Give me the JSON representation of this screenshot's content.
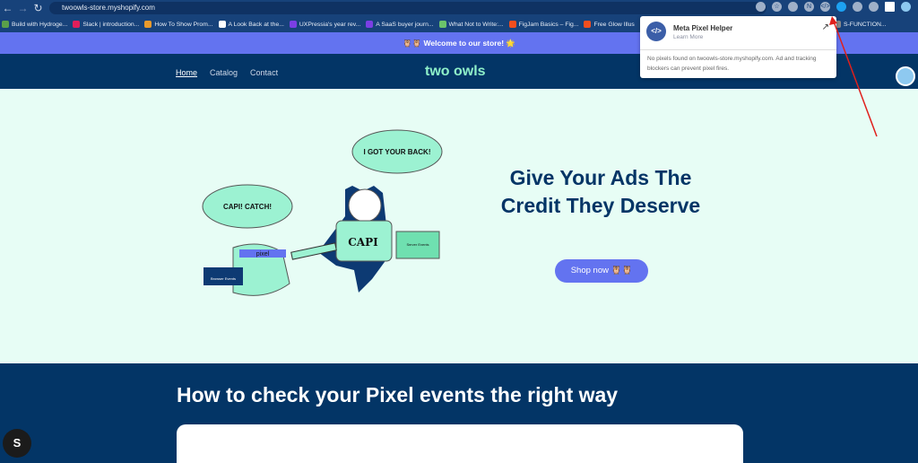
{
  "browser": {
    "url": "twoowls-store.myshopify.com",
    "bookmarks": [
      "Build with Hydroge...",
      "Slack | introduction...",
      "How To Show Prom...",
      "A Look Back at the...",
      "UXPressia's year rev...",
      "A SaaS buyer journ...",
      "What Not to Write:...",
      "FigJam Basics – Fig...",
      "Free Glow Illus",
      "S-FUNCTION..."
    ],
    "bookmark_colors": [
      "#5aa04a",
      "#e01e5a",
      "#e89a2c",
      "#ffffff",
      "#7b3fe4",
      "#7b3fe4",
      "#6bc36b",
      "#f24e1e",
      "#f24e1e",
      "#888888"
    ]
  },
  "announcement": "🦉🦉 Welcome to our store! 🌟",
  "header": {
    "nav": [
      "Home",
      "Catalog",
      "Contact"
    ],
    "logo": "two owls"
  },
  "hero": {
    "title": "Give Your Ads The Credit They Deserve",
    "button": "Shop now 🦉🦉",
    "bubble1": "I GOT YOUR BACK!",
    "bubble2": "CAPI! CATCH!",
    "shirt": "CAPI",
    "headband": "pixel",
    "box1": "Server Events",
    "box2": "Browser Events"
  },
  "section": {
    "title": "How to check your Pixel events the right way"
  },
  "popup": {
    "title": "Meta Pixel Helper",
    "link": "Learn More",
    "message": "No pixels found on twoowls-store.myshopify.com. Ad and tracking blockers can prevent pixel fires."
  },
  "colors": {
    "brand": "#033566",
    "accent": "#6373f0",
    "mint": "#8ff0c9",
    "hero_bg": "#e7fdf5"
  }
}
